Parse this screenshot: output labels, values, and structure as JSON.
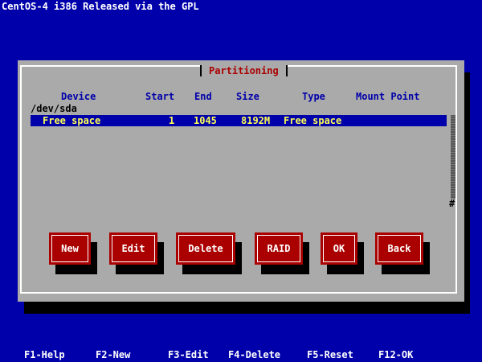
{
  "banner": "CentOS-4 i386 Released via the GPL",
  "dialog": {
    "title": "Partitioning",
    "columns": {
      "device": "Device",
      "start": "Start",
      "end": "End",
      "size": "Size",
      "type": "Type",
      "mount": "Mount Point"
    },
    "disk": "/dev/sda",
    "row": {
      "device": "Free space",
      "start": "1",
      "end": "1045",
      "size": "8192M",
      "type": "Free space",
      "mount": ""
    },
    "scroll_thumb": "#"
  },
  "buttons": {
    "new": "New",
    "edit": "Edit",
    "delete": "Delete",
    "raid": "RAID",
    "ok": "OK",
    "back": "Back"
  },
  "function_keys": [
    "F1-Help",
    "F2-New",
    "F3-Edit",
    "F4-Delete",
    "F5-Reset",
    "F12-OK"
  ]
}
